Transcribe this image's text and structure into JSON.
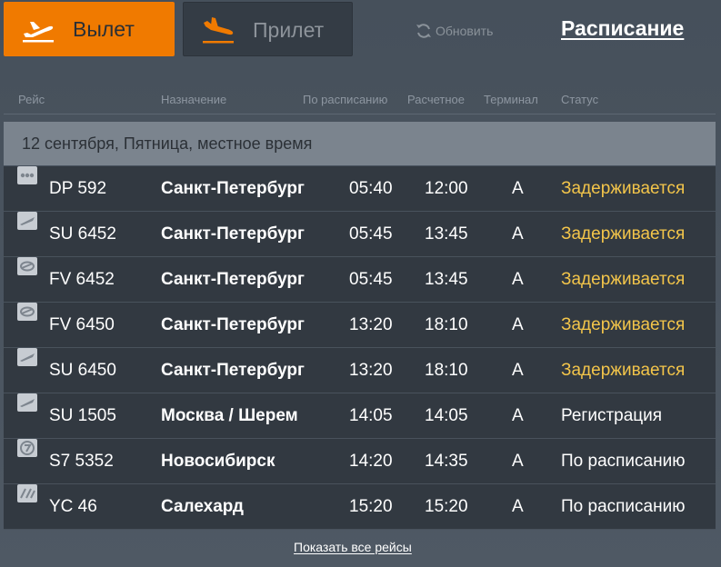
{
  "tabs": {
    "departures": {
      "label": "Вылет",
      "icon": "plane-takeoff-icon",
      "active": true
    },
    "arrivals": {
      "label": "Прилет",
      "icon": "plane-landing-icon",
      "active": false
    }
  },
  "refresh": {
    "label": "Обновить",
    "icon": "refresh-icon"
  },
  "schedule_link": "Расписание",
  "columns": {
    "flight": "Рейс",
    "destination": "Назначение",
    "scheduled": "По расписанию",
    "estimated": "Расчетное",
    "terminal": "Терминал",
    "status": "Статус"
  },
  "date_header": "12 сентября, Пятница, местное время",
  "flights": [
    {
      "logo": "airline-logo-dp-icon",
      "flight": "DP 592",
      "destination": "Санкт-Петербург",
      "scheduled": "05:40",
      "estimated": "12:00",
      "terminal": "A",
      "status": "Задерживается",
      "delayed": true
    },
    {
      "logo": "airline-logo-su-icon",
      "flight": "SU 6452",
      "destination": "Санкт-Петербург",
      "scheduled": "05:45",
      "estimated": "13:45",
      "terminal": "A",
      "status": "Задерживается",
      "delayed": true
    },
    {
      "logo": "airline-logo-fv-icon",
      "flight": "FV 6452",
      "destination": "Санкт-Петербург",
      "scheduled": "05:45",
      "estimated": "13:45",
      "terminal": "A",
      "status": "Задерживается",
      "delayed": true
    },
    {
      "logo": "airline-logo-fv-icon",
      "flight": "FV 6450",
      "destination": "Санкт-Петербург",
      "scheduled": "13:20",
      "estimated": "18:10",
      "terminal": "A",
      "status": "Задерживается",
      "delayed": true
    },
    {
      "logo": "airline-logo-su-icon",
      "flight": "SU 6450",
      "destination": "Санкт-Петербург",
      "scheduled": "13:20",
      "estimated": "18:10",
      "terminal": "A",
      "status": "Задерживается",
      "delayed": true
    },
    {
      "logo": "airline-logo-su-icon",
      "flight": "SU 1505",
      "destination": "Москва / Шерем",
      "scheduled": "14:05",
      "estimated": "14:05",
      "terminal": "A",
      "status": "Регистрация",
      "delayed": false
    },
    {
      "logo": "airline-logo-s7-icon",
      "flight": "S7 5352",
      "destination": "Новосибирск",
      "scheduled": "14:20",
      "estimated": "14:35",
      "terminal": "A",
      "status": "По расписанию",
      "delayed": false
    },
    {
      "logo": "airline-logo-yc-icon",
      "flight": "YC 46",
      "destination": "Салехард",
      "scheduled": "15:20",
      "estimated": "15:20",
      "terminal": "A",
      "status": "По расписанию",
      "delayed": false
    }
  ],
  "show_all_link": "Показать все рейсы",
  "colors": {
    "accent_orange": "#f07a00",
    "status_delayed": "#f3c54a",
    "row_background": "#323941",
    "date_bar": "#7b848e"
  }
}
